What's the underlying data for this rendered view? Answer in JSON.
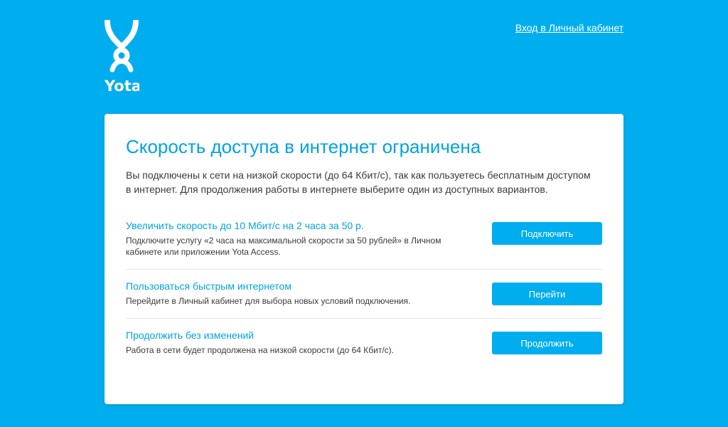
{
  "header": {
    "logo_text": "Yota",
    "login_link": "Вход в Личный кабинет"
  },
  "card": {
    "title": "Скорость доступа в интернет ограничена",
    "description": "Вы подключены к сети на низкой скорости (до 64 Кбит/с), так как пользуетесь бесплатным доступом в интернет. Для продолжения работы в интернете выберите один из доступных вариантов.",
    "options": [
      {
        "title": "Увеличить скорость до 10 Мбит/с на 2 часа за 50 р.",
        "description": "Подключите услугу «2 часа на максимальной скорости за 50 рублей» в Личном кабинете или приложении Yota Access.",
        "button": "Подключить"
      },
      {
        "title": "Пользоваться быстрым интернетом",
        "description": "Перейдите в Личный кабинет для выбора новых условий подключения.",
        "button": "Перейти"
      },
      {
        "title": "Продолжить без изменений",
        "description": "Работа в сети будет продолжена на низкой скорости (до 64 Кбит/с).",
        "button": "Продолжить"
      }
    ]
  },
  "colors": {
    "background": "#00adee",
    "accent": "#00a3e0",
    "card": "#ffffff"
  }
}
